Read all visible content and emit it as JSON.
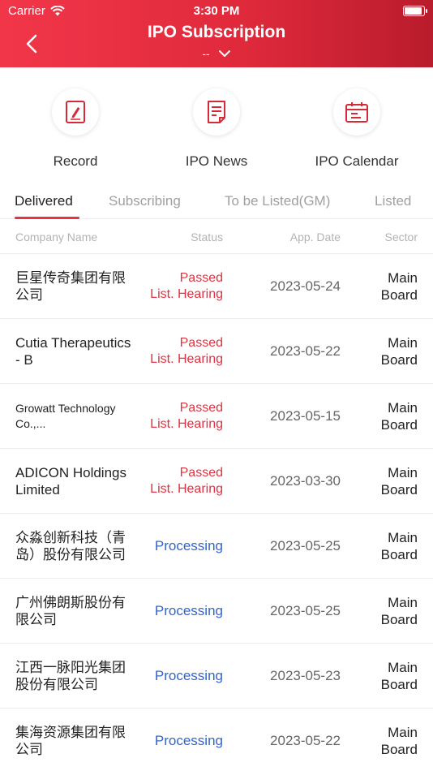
{
  "status_bar": {
    "carrier": "Carrier",
    "time": "3:30 PM"
  },
  "header": {
    "title": "IPO Subscription",
    "subtitle": "--"
  },
  "shortcuts": [
    {
      "label": "Record",
      "icon": "record-icon"
    },
    {
      "label": "IPO News",
      "icon": "news-icon"
    },
    {
      "label": "IPO Calendar",
      "icon": "calendar-icon"
    }
  ],
  "tabs": [
    {
      "label": "Delivered",
      "active": true
    },
    {
      "label": "Subscribing",
      "active": false
    },
    {
      "label": "To be Listed(GM)",
      "active": false
    },
    {
      "label": "Listed",
      "active": false
    }
  ],
  "columns": {
    "company": "Company Name",
    "status": "Status",
    "date": "App. Date",
    "sector": "Sector"
  },
  "rows": [
    {
      "name": "巨星传奇集团有限公司",
      "status1": "Passed",
      "status2": "List. Hearing",
      "date": "2023-05-24",
      "sector1": "Main",
      "sector2": "Board"
    },
    {
      "name": "Cutia Therapeutics - B",
      "status1": "Passed",
      "status2": "List. Hearing",
      "date": "2023-05-22",
      "sector1": "Main",
      "sector2": "Board"
    },
    {
      "name": "Growatt Technology Co.,...",
      "status1": "Passed",
      "status2": "List. Hearing",
      "date": "2023-05-15",
      "sector1": "Main",
      "sector2": "Board"
    },
    {
      "name": "ADICON Holdings Limited",
      "status1": "Passed",
      "status2": "List. Hearing",
      "date": "2023-03-30",
      "sector1": "Main",
      "sector2": "Board"
    },
    {
      "name": "众淼创新科技（青岛）股份有限公司",
      "status1": "Processing",
      "status2": "",
      "date": "2023-05-25",
      "sector1": "Main",
      "sector2": "Board"
    },
    {
      "name": "广州佛朗斯股份有限公司",
      "status1": "Processing",
      "status2": "",
      "date": "2023-05-25",
      "sector1": "Main",
      "sector2": "Board"
    },
    {
      "name": "江西一脉阳光集团股份有限公司",
      "status1": "Processing",
      "status2": "",
      "date": "2023-05-23",
      "sector1": "Main",
      "sector2": "Board"
    },
    {
      "name": "集海资源集团有限公司",
      "status1": "Processing",
      "status2": "",
      "date": "2023-05-22",
      "sector1": "Main",
      "sector2": "Board"
    }
  ],
  "colors": {
    "accent": "#e8323f",
    "processing": "#3264d0"
  }
}
